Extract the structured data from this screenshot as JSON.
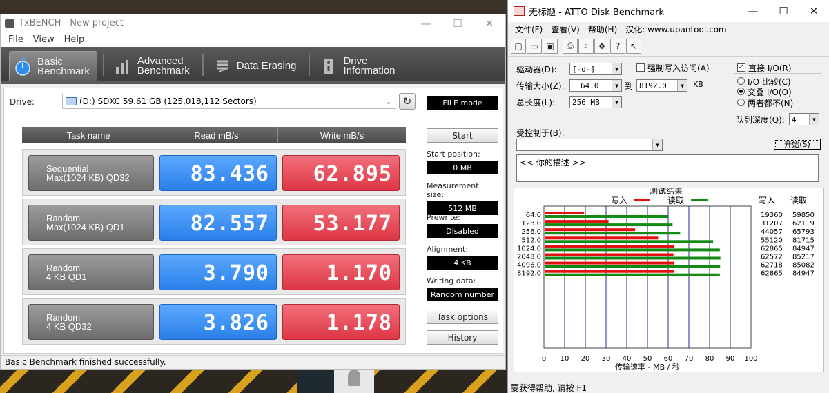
{
  "txbench": {
    "title": "TxBENCH - New project",
    "window_controls": [
      "—",
      "☐",
      "✕"
    ],
    "menu": [
      "File",
      "View",
      "Help"
    ],
    "tabs": [
      {
        "line1": "Basic",
        "line2": "Benchmark",
        "icon": "stopwatch-icon",
        "active": true
      },
      {
        "line1": "Advanced",
        "line2": "Benchmark",
        "icon": "bar-chart-icon",
        "active": false
      },
      {
        "line1": "Data Erasing",
        "line2": "",
        "icon": "eraser-icon",
        "active": false
      },
      {
        "line1": "Drive",
        "line2": "Information",
        "icon": "drive-info-icon",
        "active": false
      }
    ],
    "drive_label": "Drive:",
    "drive_value": "(D:) SDXC  59.61 GB (125,018,112 Sectors)",
    "file_mode": "FILE mode",
    "headers": {
      "task": "Task name",
      "read": "Read mB/s",
      "write": "Write mB/s"
    },
    "rows": [
      {
        "task1": "Sequential",
        "task2": "Max(1024 KB) QD32",
        "read": "83.436",
        "write": "62.895"
      },
      {
        "task1": "Random",
        "task2": "Max(1024 KB) QD1",
        "read": "82.557",
        "write": "53.177"
      },
      {
        "task1": "Random",
        "task2": "4 KB QD1",
        "read": "3.790",
        "write": "1.170"
      },
      {
        "task1": "Random",
        "task2": "4 KB QD32",
        "read": "3.826",
        "write": "1.178"
      }
    ],
    "start_button": "Start",
    "start_position_label": "Start position:",
    "start_position_value": "0 MB",
    "measurement_size_label": "Measurement size:",
    "measurement_size_value": "512 MB",
    "prewrite_label": "Prewrite:",
    "prewrite_value": "Disabled",
    "alignment_label": "Alignment:",
    "alignment_value": "4 KB",
    "writing_data_label": "Writing data:",
    "writing_data_value": "Random number",
    "task_options_button": "Task options",
    "history_button": "History",
    "status": "Basic Benchmark finished successfully."
  },
  "atto": {
    "title": "无标题 - ATTO Disk Benchmark",
    "window_controls": [
      "—",
      "☐",
      "✕"
    ],
    "menu": [
      "文件(F)",
      "查看(V)",
      "帮助(H)",
      "汉化: www.upantool.com"
    ],
    "drive_label": "驱动器(D):",
    "drive_value": "[-d-]",
    "force_write_label": "强制写入访问(A)",
    "direct_io_label": "直接 I/O(R)",
    "transfer_label": "传输大小(Z):",
    "transfer_from": "64.0",
    "to_label": "到",
    "transfer_to": "8192.0",
    "kb_label": "KB",
    "total_label": "总长度(L):",
    "total_value": "256 MB",
    "radio_io_compare": "I/O 比较(C)",
    "radio_overlap": "交叠 I/O(O)",
    "radio_neither": "两者都不(N)",
    "queue_label": "队列深度(Q):",
    "queue_value": "4",
    "controlled_label": "受控制于(B):",
    "controlled_value": "",
    "start_button": "开始(S)",
    "description": "<<  你的描述   >>",
    "status": "要获得帮助, 请按 F1"
  },
  "chart_data": {
    "type": "bar",
    "title": "测试结果",
    "legend": [
      {
        "name": "写入",
        "color": "#e21010"
      },
      {
        "name": "读取",
        "color": "#138a13"
      }
    ],
    "categories": [
      "64.0",
      "128.0",
      "256.0",
      "512.0",
      "1024.0",
      "2048.0",
      "4096.0",
      "8192.0"
    ],
    "series": [
      {
        "name": "写入",
        "values": [
          19360,
          31207,
          44057,
          55120,
          62865,
          62572,
          62718,
          62865
        ]
      },
      {
        "name": "读取",
        "values": [
          59850,
          62119,
          65793,
          81715,
          84947,
          85217,
          85082,
          84947
        ]
      }
    ],
    "col_headers": [
      "写入",
      "读取"
    ],
    "write_col": [
      "19360",
      "31207",
      "44057",
      "55120",
      "62865",
      "62572",
      "62718",
      "62865"
    ],
    "read_col": [
      "59850",
      "62119",
      "65793",
      "81715",
      "84947",
      "85217",
      "85082",
      "84947"
    ],
    "x_ticks": [
      "0",
      "10",
      "20",
      "30",
      "40",
      "50",
      "60",
      "70",
      "80",
      "90",
      "100"
    ],
    "xlim": [
      0,
      100
    ],
    "xlabel": "传输速率 - MB / 秒",
    "legend_position": "top",
    "grid": true
  }
}
